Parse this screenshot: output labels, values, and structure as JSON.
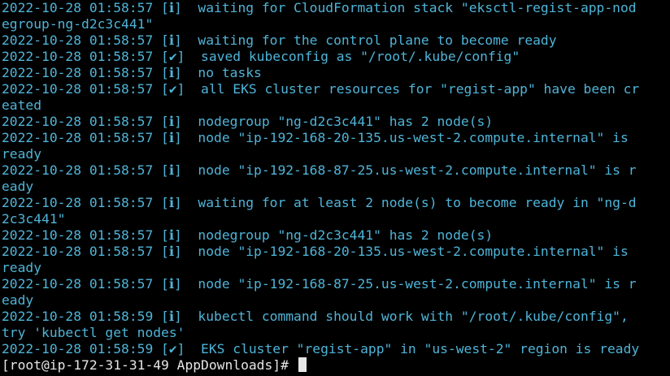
{
  "colors": {
    "background": "#000000",
    "log_text": "#4fb4d8",
    "prompt_text": "#e6e6e6"
  },
  "terminal": {
    "lines": [
      "2022-10-28 01:58:57 [ℹ]  waiting for CloudFormation stack \"eksctl-regist-app-nod",
      "egroup-ng-d2c3c441\"",
      "2022-10-28 01:58:57 [ℹ]  waiting for the control plane to become ready",
      "2022-10-28 01:58:57 [✔]  saved kubeconfig as \"/root/.kube/config\"",
      "2022-10-28 01:58:57 [ℹ]  no tasks",
      "2022-10-28 01:58:57 [✔]  all EKS cluster resources for \"regist-app\" have been cr",
      "eated",
      "2022-10-28 01:58:57 [ℹ]  nodegroup \"ng-d2c3c441\" has 2 node(s)",
      "2022-10-28 01:58:57 [ℹ]  node \"ip-192-168-20-135.us-west-2.compute.internal\" is",
      "ready",
      "2022-10-28 01:58:57 [ℹ]  node \"ip-192-168-87-25.us-west-2.compute.internal\" is r",
      "eady",
      "2022-10-28 01:58:57 [ℹ]  waiting for at least 2 node(s) to become ready in \"ng-d",
      "2c3c441\"",
      "2022-10-28 01:58:57 [ℹ]  nodegroup \"ng-d2c3c441\" has 2 node(s)",
      "2022-10-28 01:58:57 [ℹ]  node \"ip-192-168-20-135.us-west-2.compute.internal\" is",
      "ready",
      "2022-10-28 01:58:57 [ℹ]  node \"ip-192-168-87-25.us-west-2.compute.internal\" is r",
      "eady",
      "2022-10-28 01:58:59 [ℹ]  kubectl command should work with \"/root/.kube/config\",",
      "try 'kubectl get nodes'",
      "2022-10-28 01:58:59 [✔]  EKS cluster \"regist-app\" in \"us-west-2\" region is ready"
    ],
    "prompt": "[root@ip-172-31-31-49 AppDownloads]# "
  }
}
